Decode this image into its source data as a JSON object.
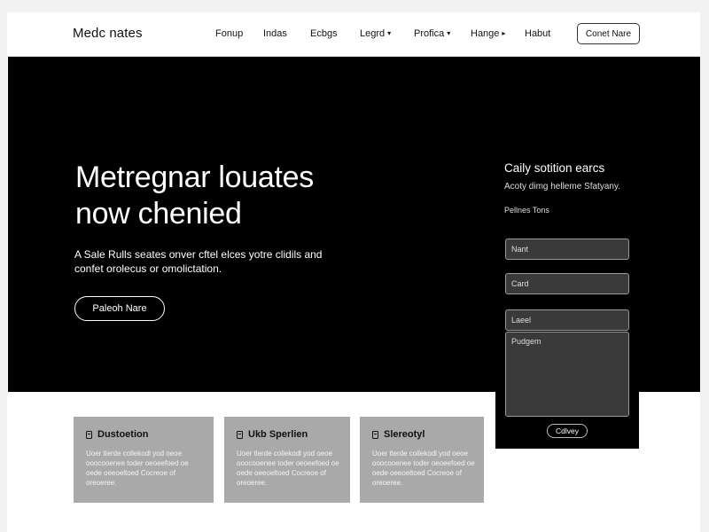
{
  "header": {
    "brand": "Medc nates",
    "nav": [
      {
        "label": "Fonup",
        "dropdown": false
      },
      {
        "label": "Indas",
        "dropdown": false
      },
      {
        "label": "Ecbgs",
        "dropdown": false
      },
      {
        "label": "Legrd",
        "dropdown": true
      },
      {
        "label": "Profica",
        "dropdown": true
      },
      {
        "label": "Hange",
        "dropdown": true
      },
      {
        "label": "Habut",
        "dropdown": false
      }
    ],
    "cta_label": "Conet Nare"
  },
  "hero": {
    "title_line1": "Metregnar louates",
    "title_line2": "now chenied",
    "body_line1": "A Sale Rulls seates onver cftel elces yotre clidils and",
    "body_line2": "confet orolecus or omolictation.",
    "cta_label": "Paleoh Nare"
  },
  "contact": {
    "title": "Caily sotition earcs",
    "subtitle": "Acoty dimg helleme Sfatyany.",
    "label": "Pellnes Tons",
    "fields": [
      {
        "placeholder": "Nant"
      },
      {
        "placeholder": "Card"
      },
      {
        "placeholder": "Laeel"
      }
    ],
    "message_placeholder": "Pudgem",
    "submit_label": "Cdlvey"
  },
  "cards": [
    {
      "title": "Dustoetion",
      "icon": "document-icon",
      "body": "Uoer tlerde collekodl yod oeoe ooocooenee toder oeoeefoed oe oede oeeoeltoed Cocreoe of oreoeree."
    },
    {
      "title": "Ukb Sperlien",
      "icon": "document-icon",
      "body": "Uoer tlerde collekodl yod oeoe ooocooenee toder oeoeefoed oe oede oeeoeltoed Cocreoe of oreoeree."
    },
    {
      "title": "Slereotyl",
      "icon": "document-icon",
      "body": "Uoer tlerde collekodl yod oeoe ooocooenee toder oeoeefoed oe oede oeeoeltoed Cocreoe of oreoeree."
    }
  ]
}
